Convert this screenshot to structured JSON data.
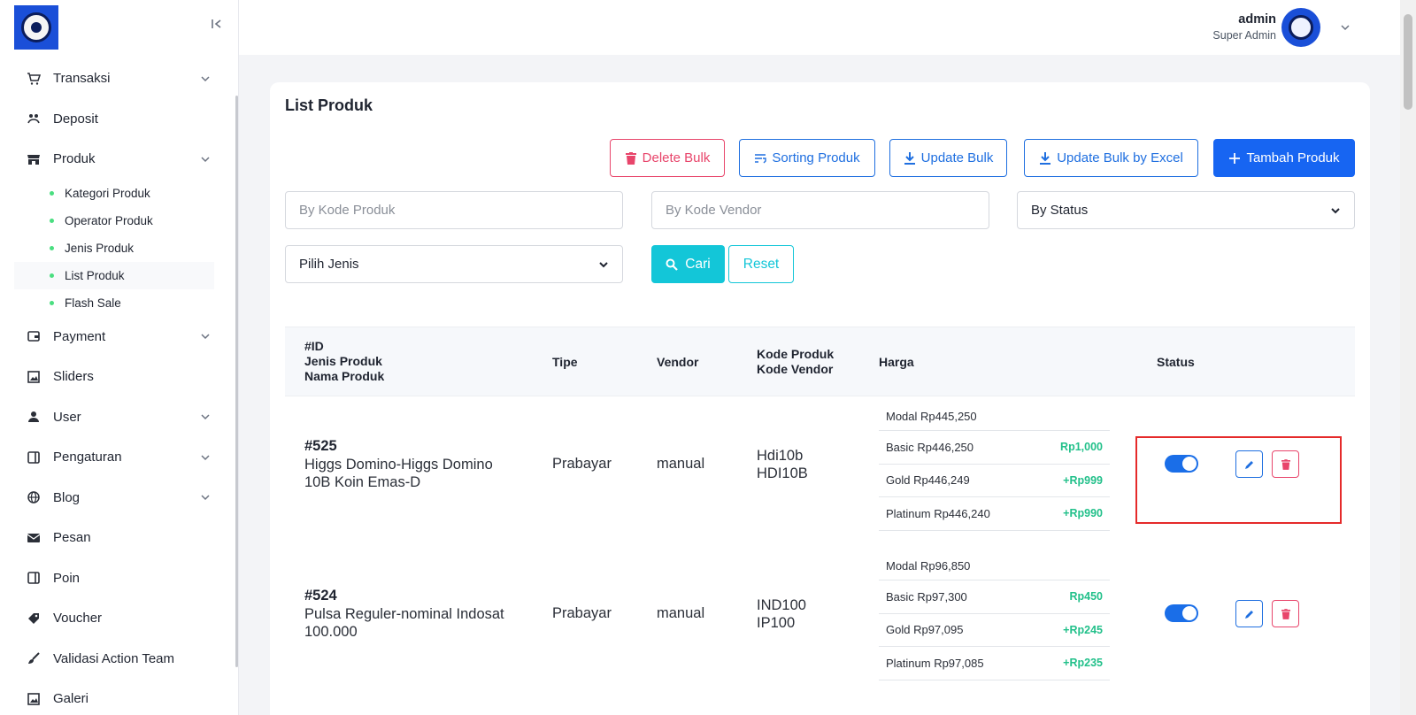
{
  "sidebar": {
    "items": [
      {
        "label": "Transaksi",
        "icon": "cart-icon",
        "has_children": true
      },
      {
        "label": "Deposit",
        "icon": "deposit-icon",
        "has_children": false
      },
      {
        "label": "Produk",
        "icon": "store-icon",
        "has_children": true
      },
      {
        "label": "Payment",
        "icon": "wallet-icon",
        "has_children": true
      },
      {
        "label": "Sliders",
        "icon": "image-icon",
        "has_children": false
      },
      {
        "label": "User",
        "icon": "user-icon",
        "has_children": true
      },
      {
        "label": "Pengaturan",
        "icon": "settings-panel-icon",
        "has_children": true
      },
      {
        "label": "Blog",
        "icon": "globe-icon",
        "has_children": true
      },
      {
        "label": "Pesan",
        "icon": "mail-icon",
        "has_children": false
      },
      {
        "label": "Poin",
        "icon": "points-icon",
        "has_children": false
      },
      {
        "label": "Voucher",
        "icon": "tag-icon",
        "has_children": false
      },
      {
        "label": "Validasi Action Team",
        "icon": "check-brush-icon",
        "has_children": false
      },
      {
        "label": "Galeri",
        "icon": "gallery-icon",
        "has_children": false
      }
    ],
    "produk_sub": [
      "Kategori Produk",
      "Operator Produk",
      "Jenis Produk",
      "List Produk",
      "Flash Sale"
    ],
    "active_sub": "List Produk"
  },
  "header": {
    "user_name": "admin",
    "user_role": "Super Admin"
  },
  "page": {
    "title": "List Produk",
    "buttons": {
      "delete_bulk": "Delete Bulk",
      "sorting": "Sorting Produk",
      "update_bulk": "Update Bulk",
      "update_excel": "Update Bulk by Excel",
      "add": "Tambah Produk"
    },
    "filters": {
      "kode_produk_placeholder": "By Kode Produk",
      "kode_vendor_placeholder": "By Kode Vendor",
      "status_selected": "By Status",
      "jenis_selected": "Pilih Jenis",
      "search_label": "Cari",
      "reset_label": "Reset"
    }
  },
  "table": {
    "headers": {
      "id_line1": "#ID",
      "id_line2": "Jenis Produk",
      "id_line3": "Nama Produk",
      "tipe": "Tipe",
      "vendor": "Vendor",
      "kode_line1": "Kode Produk",
      "kode_line2": "Kode Vendor",
      "harga": "Harga",
      "status": "Status"
    },
    "rows": [
      {
        "id": "#525",
        "name": "Higgs Domino-Higgs Domino 10B Koin Emas-D",
        "tipe": "Prabayar",
        "vendor": "manual",
        "kode_produk": "Hdi10b",
        "kode_vendor": "HDI10B",
        "modal": "Modal Rp445,250",
        "prices": [
          {
            "label": "Basic Rp446,250",
            "diff": "Rp1,000"
          },
          {
            "label": "Gold Rp446,249",
            "diff": "+Rp999"
          },
          {
            "label": "Platinum Rp446,240",
            "diff": "+Rp990"
          }
        ],
        "status_on": true
      },
      {
        "id": "#524",
        "name": "Pulsa Reguler-nominal Indosat 100.000",
        "tipe": "Prabayar",
        "vendor": "manual",
        "kode_produk": "IND100",
        "kode_vendor": "IP100",
        "modal": "Modal Rp96,850",
        "prices": [
          {
            "label": "Basic Rp97,300",
            "diff": "Rp450"
          },
          {
            "label": "Gold Rp97,095",
            "diff": "+Rp245"
          },
          {
            "label": "Platinum Rp97,085",
            "diff": "+Rp235"
          }
        ],
        "status_on": true
      }
    ]
  },
  "colors": {
    "primary": "#1765f2",
    "danger": "#e8456b",
    "cyan": "#13c6d8",
    "success_text": "#22c08a",
    "highlight": "#e52a2a"
  }
}
